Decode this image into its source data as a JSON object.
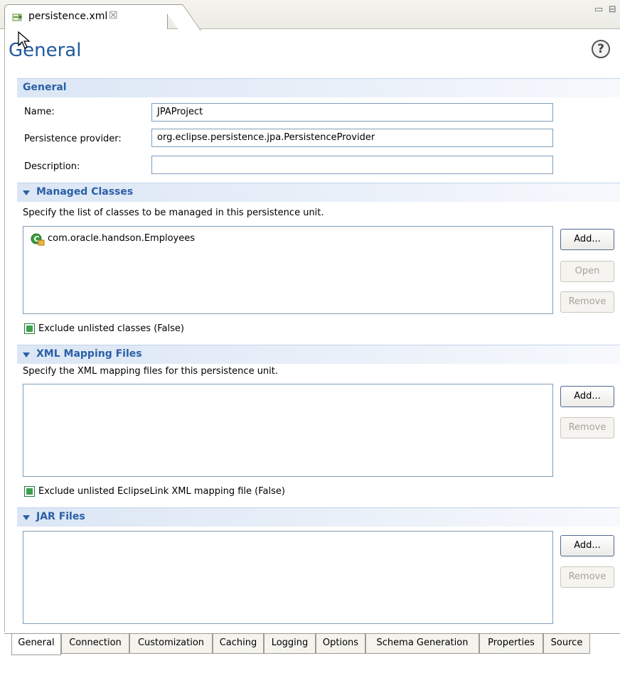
{
  "editor_tab": {
    "title": "persistence.xml",
    "close": "☒"
  },
  "view_controls": {
    "minimize": "▭",
    "maximize": "⊟"
  },
  "form": {
    "title": "General",
    "help": "?"
  },
  "general": {
    "heading": "General",
    "name_label": "Name:",
    "name_value": "JPAProject",
    "provider_label": "Persistence provider:",
    "provider_value": "org.eclipse.persistence.jpa.PersistenceProvider",
    "description_label": "Description:",
    "description_value": ""
  },
  "managed_classes": {
    "heading": "Managed Classes",
    "description": "Specify the list of classes to be managed in this persistence unit.",
    "items": [
      {
        "label": "com.oracle.handson.Employees",
        "icon": "entity-class-icon"
      }
    ],
    "add": "Add...",
    "open": "Open",
    "remove": "Remove",
    "exclude_label": "Exclude unlisted classes (False)"
  },
  "xml_mapping_files": {
    "heading": "XML Mapping Files",
    "description": "Specify the XML mapping files for this persistence unit.",
    "add": "Add...",
    "remove": "Remove",
    "exclude_label": "Exclude unlisted EclipseLink XML mapping file (False)"
  },
  "jar_files": {
    "heading": "JAR Files",
    "add": "Add...",
    "remove": "Remove"
  },
  "page_tabs": [
    "General",
    "Connection",
    "Customization",
    "Caching",
    "Logging",
    "Options",
    "Schema Generation",
    "Properties",
    "Source"
  ],
  "colors": {
    "section_title": "#2b5fa5",
    "form_title": "#225a9c",
    "checkbox": "#3fa04d"
  }
}
